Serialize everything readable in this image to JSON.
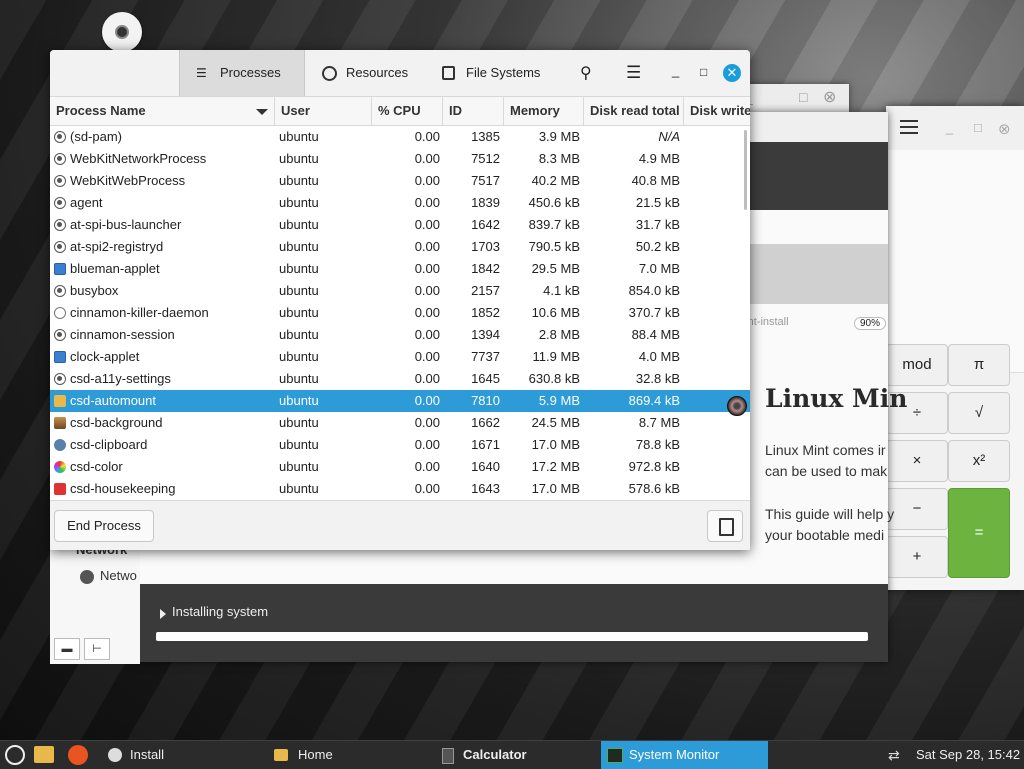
{
  "system_monitor": {
    "tabs": [
      {
        "label": "Processes",
        "icon": "list-icon"
      },
      {
        "label": "Resources",
        "icon": "gauge-icon"
      },
      {
        "label": "File Systems",
        "icon": "disk-icon"
      }
    ],
    "columns": [
      "Process Name",
      "User",
      "% CPU",
      "ID",
      "Memory",
      "Disk read total",
      "Disk write"
    ],
    "processes": [
      {
        "icon": "gear",
        "name": "(sd-pam)",
        "user": "ubuntu",
        "cpu": "0.00",
        "id": "1385",
        "memory": "3.9 MB",
        "disk_read": "N/A"
      },
      {
        "icon": "gear",
        "name": "WebKitNetworkProcess",
        "user": "ubuntu",
        "cpu": "0.00",
        "id": "7512",
        "memory": "8.3 MB",
        "disk_read": "4.9 MB"
      },
      {
        "icon": "gear",
        "name": "WebKitWebProcess",
        "user": "ubuntu",
        "cpu": "0.00",
        "id": "7517",
        "memory": "40.2 MB",
        "disk_read": "40.8 MB"
      },
      {
        "icon": "gear",
        "name": "agent",
        "user": "ubuntu",
        "cpu": "0.00",
        "id": "1839",
        "memory": "450.6 kB",
        "disk_read": "21.5 kB"
      },
      {
        "icon": "gear",
        "name": "at-spi-bus-launcher",
        "user": "ubuntu",
        "cpu": "0.00",
        "id": "1642",
        "memory": "839.7 kB",
        "disk_read": "31.7 kB"
      },
      {
        "icon": "gear",
        "name": "at-spi2-registryd",
        "user": "ubuntu",
        "cpu": "0.00",
        "id": "1703",
        "memory": "790.5 kB",
        "disk_read": "50.2 kB"
      },
      {
        "icon": "blue",
        "name": "blueman-applet",
        "user": "ubuntu",
        "cpu": "0.00",
        "id": "1842",
        "memory": "29.5 MB",
        "disk_read": "7.0 MB"
      },
      {
        "icon": "gear",
        "name": "busybox",
        "user": "ubuntu",
        "cpu": "0.00",
        "id": "2157",
        "memory": "4.1 kB",
        "disk_read": "854.0 kB"
      },
      {
        "icon": "ring",
        "name": "cinnamon-killer-daemon",
        "user": "ubuntu",
        "cpu": "0.00",
        "id": "1852",
        "memory": "10.6 MB",
        "disk_read": "370.7 kB"
      },
      {
        "icon": "gear",
        "name": "cinnamon-session",
        "user": "ubuntu",
        "cpu": "0.00",
        "id": "1394",
        "memory": "2.8 MB",
        "disk_read": "88.4 MB"
      },
      {
        "icon": "blue",
        "name": "clock-applet",
        "user": "ubuntu",
        "cpu": "0.00",
        "id": "7737",
        "memory": "11.9 MB",
        "disk_read": "4.0 MB"
      },
      {
        "icon": "gear",
        "name": "csd-a11y-settings",
        "user": "ubuntu",
        "cpu": "0.00",
        "id": "1645",
        "memory": "630.8 kB",
        "disk_read": "32.8 kB"
      },
      {
        "icon": "folder",
        "name": "csd-automount",
        "user": "ubuntu",
        "cpu": "0.00",
        "id": "7810",
        "memory": "5.9 MB",
        "disk_read": "869.4 kB",
        "selected": true
      },
      {
        "icon": "img",
        "name": "csd-background",
        "user": "ubuntu",
        "cpu": "0.00",
        "id": "1662",
        "memory": "24.5 MB",
        "disk_read": "8.7 MB"
      },
      {
        "icon": "clip",
        "name": "csd-clipboard",
        "user": "ubuntu",
        "cpu": "0.00",
        "id": "1671",
        "memory": "17.0 MB",
        "disk_read": "78.8 kB"
      },
      {
        "icon": "color",
        "name": "csd-color",
        "user": "ubuntu",
        "cpu": "0.00",
        "id": "1640",
        "memory": "17.2 MB",
        "disk_read": "972.8 kB"
      },
      {
        "icon": "red",
        "name": "csd-housekeeping",
        "user": "ubuntu",
        "cpu": "0.00",
        "id": "1643",
        "memory": "17.0 MB",
        "disk_read": "578.6 kB"
      }
    ],
    "end_process_label": "End Process"
  },
  "installer": {
    "url_fragment": "mint-install",
    "zoom": "90%",
    "heading": "Linux Min",
    "para1_line1": "Linux Mint comes ir",
    "para1_line2": "can be used to mak",
    "para2_line1": "This guide will help y",
    "para2_line2": "your bootable medi",
    "status": "Installing system"
  },
  "file_manager": {
    "network_header": "Network",
    "network_item": "Netwo"
  },
  "calculator": {
    "buttons": [
      "mod",
      "π",
      "÷",
      "√",
      "×",
      "x²",
      "−",
      "=",
      "+"
    ]
  },
  "taskbar": {
    "items": [
      "Install",
      "Home",
      "Calculator",
      "System Monitor"
    ],
    "clock": "Sat Sep 28, 15:42"
  }
}
